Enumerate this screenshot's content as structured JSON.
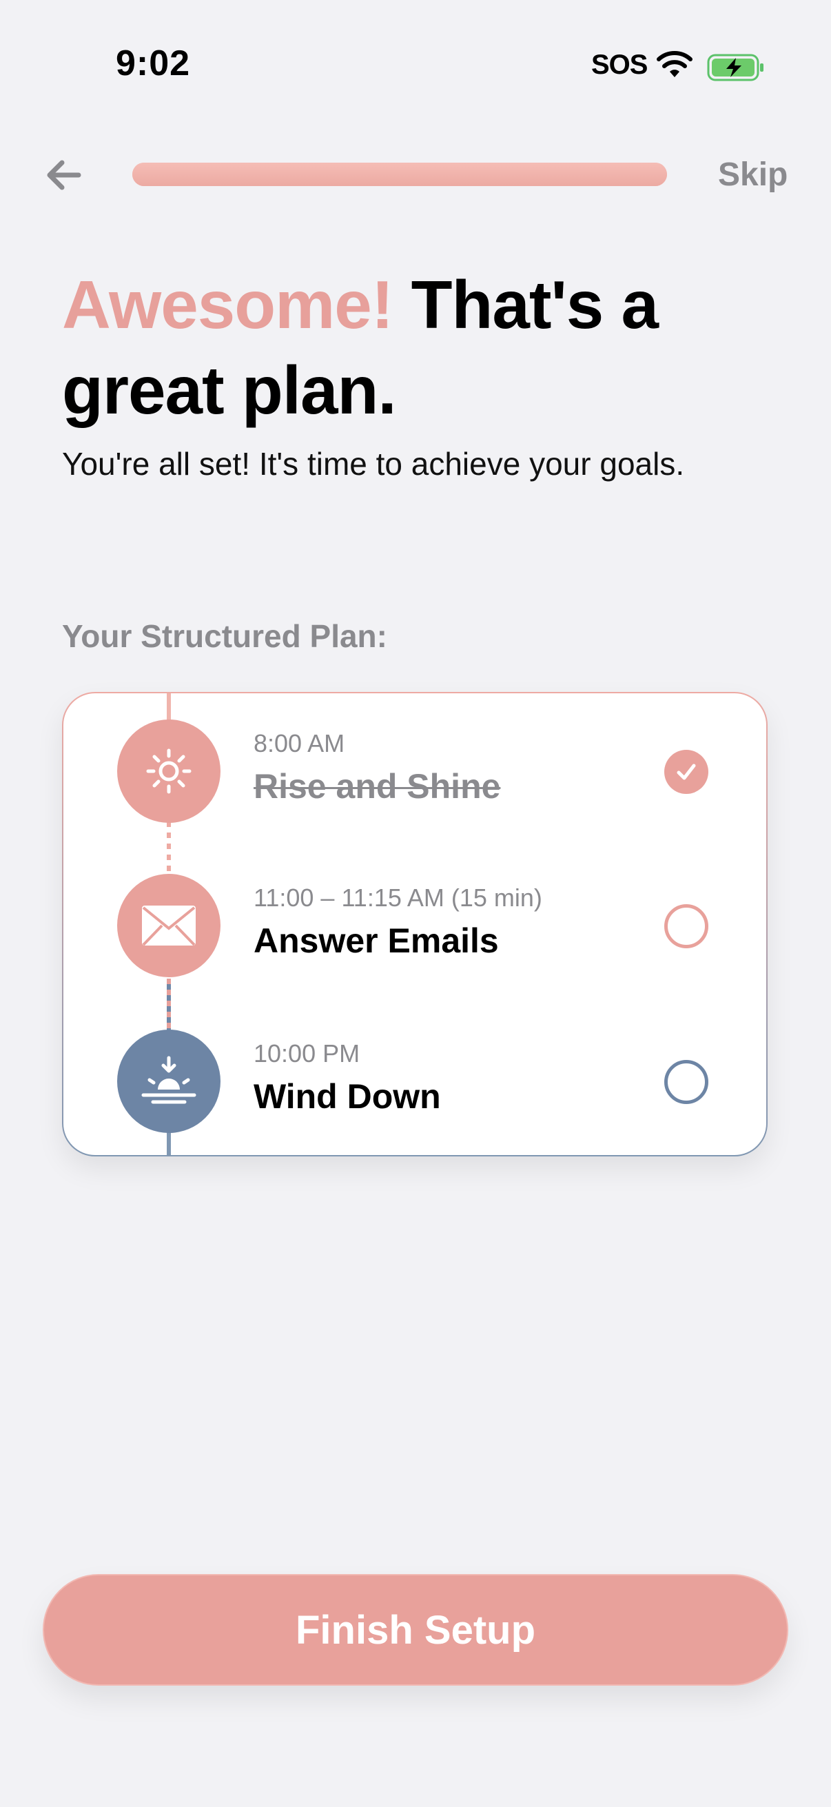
{
  "status_bar": {
    "time": "9:02",
    "sos": "SOS"
  },
  "nav": {
    "skip_label": "Skip",
    "progress_fraction": 1.0
  },
  "headline": {
    "accent": "Awesome!",
    "rest": " That's a great plan."
  },
  "subtitle": "You're all set! It's time to achieve your goals.",
  "section_label": "Your Structured Plan:",
  "plan": [
    {
      "time": "8:00 AM",
      "title": "Rise and Shine",
      "icon": "sun-icon",
      "completed": true
    },
    {
      "time": "11:00 – 11:15 AM (15 min)",
      "title": "Answer Emails",
      "icon": "envelope-icon",
      "completed": false
    },
    {
      "time": "10:00 PM",
      "title": "Wind Down",
      "icon": "sunset-icon",
      "completed": false
    }
  ],
  "finish_label": "Finish Setup",
  "colors": {
    "accent_pink": "#e8a19b",
    "accent_blue": "#6d85a5",
    "background": "#f2f2f5"
  }
}
